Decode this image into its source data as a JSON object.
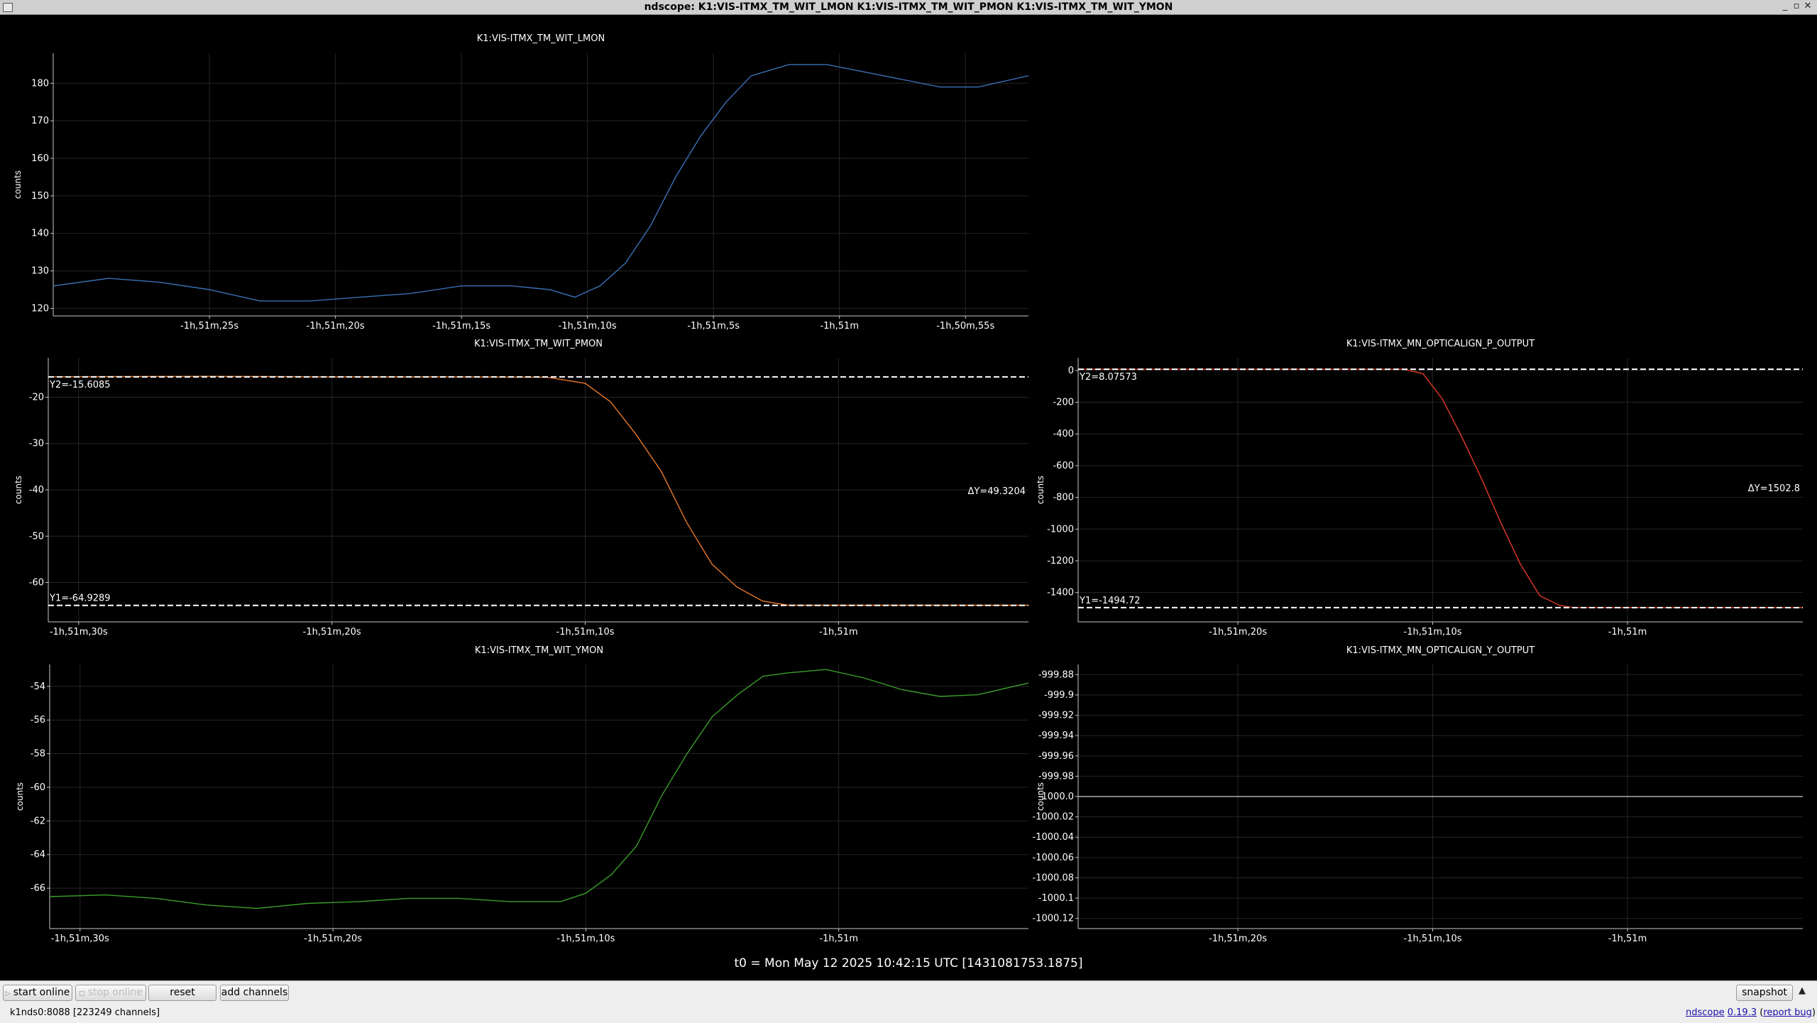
{
  "window": {
    "title": "ndscope: K1:VIS-ITMX_TM_WIT_LMON K1:VIS-ITMX_TM_WIT_PMON K1:VIS-ITMX_TM_WIT_YMON",
    "controls": [
      "_",
      "▫",
      "✕"
    ]
  },
  "t0_label": "t0 = Mon May 12 2025 10:42:15 UTC [1431081753.1875]",
  "toolbar": {
    "start_online": "start online",
    "stop_online": "stop online",
    "reset": "reset",
    "add_channels": "add channels",
    "snapshot": "snapshot",
    "collapse": "▲"
  },
  "status": {
    "server": "k1nds0:8088  [223249 channels]",
    "app_name": "ndscope",
    "version": "0.19.3",
    "report_bug": "report bug"
  },
  "colors": {
    "lmon": "#3a6fb5",
    "pmon": "#e8772a",
    "yaw_pmon": "#e03a2a",
    "ymon": "#3a9e2a",
    "ylink": "#ffffff"
  },
  "plots": [
    {
      "channel": "K1:VIS-ITMX_TM_WIT_LMON",
      "ylabel": "counts",
      "color": "lmon",
      "ylim": [
        118,
        188
      ],
      "yticks": [
        "120",
        "130",
        "140",
        "150",
        "160",
        "170",
        "180"
      ],
      "ytick_values": [
        120,
        130,
        140,
        150,
        160,
        170,
        180
      ],
      "xticks": [
        "-1h,51m,25s",
        "-1h,51m,20s",
        "-1h,51m,15s",
        "-1h,51m,10s",
        "-1h,51m,5s",
        "-1h,51m",
        "-1h,50m,55s"
      ],
      "xtick_values": [
        -6685,
        -6680,
        -6675,
        -6670,
        -6665,
        -6660,
        -6655
      ],
      "xlim": [
        -6691.2,
        -6652.5
      ],
      "series_x": [
        -6691.2,
        -6689.0,
        -6687.0,
        -6685.0,
        -6683.0,
        -6681.0,
        -6679.0,
        -6677.0,
        -6675.0,
        -6673.0,
        -6671.5,
        -6670.5,
        -6669.5,
        -6668.5,
        -6667.5,
        -6666.5,
        -6665.5,
        -6664.5,
        -6663.5,
        -6662.0,
        -6660.5,
        -6659.0,
        -6657.5,
        -6656.0,
        -6654.5,
        -6652.5
      ],
      "series_y": [
        126,
        128,
        127,
        125,
        122,
        122,
        123,
        124,
        126,
        126,
        125,
        123,
        126,
        132,
        142,
        155,
        166,
        175,
        182,
        185,
        185,
        183,
        181,
        179,
        179,
        182
      ]
    },
    {
      "channel": "K1:VIS-ITMX_TM_WIT_PMON",
      "ylabel": "counts",
      "color": "pmon",
      "ylim": [
        -68.5,
        -11.5
      ],
      "yticks": [
        "-20",
        "-30",
        "-40",
        "-50",
        "-60"
      ],
      "ytick_values": [
        -20,
        -30,
        -40,
        -50,
        -60
      ],
      "xticks": [
        "-1h,51m,30s",
        "-1h,51m,20s",
        "-1h,51m,10s",
        "-1h,51m"
      ],
      "xtick_values": [
        -6690,
        -6680,
        -6670,
        -6660
      ],
      "xlim": [
        -6691.2,
        -6652.5
      ],
      "series_x": [
        -6691.2,
        -6685.0,
        -6680.0,
        -6675.0,
        -6671.5,
        -6670.0,
        -6669.0,
        -6668.0,
        -6667.0,
        -6666.0,
        -6665.0,
        -6664.0,
        -6663.0,
        -6662.0,
        -6660.0,
        -6655.0,
        -6652.5
      ],
      "series_y": [
        -15.6,
        -15.5,
        -15.6,
        -15.6,
        -15.7,
        -17.0,
        -21.0,
        -28.0,
        -36.0,
        -47.0,
        -56.0,
        -61.0,
        -64.0,
        -64.9,
        -64.9,
        -64.9,
        -64.9
      ],
      "cursors": {
        "y1": "Y1=-64.9289",
        "y2": "Y2=-15.6085",
        "dy": "ΔY=49.3204",
        "y1_value": -64.9289,
        "y2_value": -15.6085
      }
    },
    {
      "channel": "K1:VIS-ITMX_TM_WIT_YMON",
      "ylabel": "counts",
      "color": "ymon",
      "ylim": [
        -68.4,
        -52.7
      ],
      "yticks": [
        "-54",
        "-56",
        "-58",
        "-60",
        "-62",
        "-64",
        "-66"
      ],
      "ytick_values": [
        -54,
        -56,
        -58,
        -60,
        -62,
        -64,
        -66
      ],
      "xticks": [
        "-1h,51m,30s",
        "-1h,51m,20s",
        "-1h,51m,10s",
        "-1h,51m"
      ],
      "xtick_values": [
        -6690,
        -6680,
        -6670,
        -6660
      ],
      "xlim": [
        -6691.2,
        -6652.5
      ],
      "series_x": [
        -6691.2,
        -6689.0,
        -6687.0,
        -6685.0,
        -6683.0,
        -6681.0,
        -6679.0,
        -6677.0,
        -6675.0,
        -6673.0,
        -6671.0,
        -6670.0,
        -6669.0,
        -6668.0,
        -6667.0,
        -6666.0,
        -6665.0,
        -6664.0,
        -6663.0,
        -6662.0,
        -6660.5,
        -6659.0,
        -6657.5,
        -6656.0,
        -6654.5,
        -6652.5
      ],
      "series_y": [
        -66.5,
        -66.4,
        -66.6,
        -67.0,
        -67.2,
        -66.9,
        -66.8,
        -66.6,
        -66.6,
        -66.8,
        -66.8,
        -66.3,
        -65.2,
        -63.5,
        -60.5,
        -58.0,
        -55.8,
        -54.5,
        -53.4,
        -53.2,
        -53.0,
        -53.5,
        -54.2,
        -54.6,
        -54.5,
        -53.8
      ]
    },
    {
      "channel": "K1:VIS-ITMX_MN_OPTICALIGN_P_OUTPUT",
      "ylabel": "counts",
      "color": "yaw_pmon",
      "ylim": [
        -1585,
        80
      ],
      "yticks": [
        "0",
        "-200",
        "-400",
        "-600",
        "-800",
        "-1000",
        "-1200",
        "-1400"
      ],
      "ytick_values": [
        0,
        -200,
        -400,
        -600,
        -800,
        -1000,
        -1200,
        -1400
      ],
      "xticks": [
        "-1h,51m,20s",
        "-1h,51m,10s",
        "-1h,51m"
      ],
      "xtick_values": [
        -6680,
        -6670,
        -6660
      ],
      "xlim": [
        -6688.2,
        -6651.0
      ],
      "series_x": [
        -6688.2,
        -6685.0,
        -6680.0,
        -6675.0,
        -6671.5,
        -6670.5,
        -6669.5,
        -6668.5,
        -6667.5,
        -6666.5,
        -6665.5,
        -6664.5,
        -6663.5,
        -6662.8,
        -6660.0,
        -6655.0,
        -6651.0
      ],
      "series_y": [
        8.1,
        8.1,
        8.1,
        8.1,
        8.1,
        -20,
        -180,
        -420,
        -680,
        -960,
        -1220,
        -1420,
        -1480,
        -1494.7,
        -1494.7,
        -1494.7,
        -1494.7
      ],
      "cursors": {
        "y1": "Y1=-1494.72",
        "y2": "Y2=8.07573",
        "dy": "ΔY=1502.8",
        "y1_value": -1494.72,
        "y2_value": 8.07573
      }
    },
    {
      "channel": "K1:VIS-ITMX_MN_OPTICALIGN_Y_OUTPUT",
      "ylabel": "counts",
      "color": "ylink",
      "ylim": [
        -1000.13,
        -999.87
      ],
      "yticks": [
        "-999.88",
        "-999.9",
        "-999.92",
        "-999.94",
        "-999.96",
        "-999.98",
        "-1000.0",
        "-1000.02",
        "-1000.04",
        "-1000.06",
        "-1000.08",
        "-1000.1",
        "-1000.12"
      ],
      "ytick_values": [
        -999.88,
        -999.9,
        -999.92,
        -999.94,
        -999.96,
        -999.98,
        -1000.0,
        -1000.02,
        -1000.04,
        -1000.06,
        -1000.08,
        -1000.1,
        -1000.12
      ],
      "xticks": [
        "-1h,51m,20s",
        "-1h,51m,10s",
        "-1h,51m"
      ],
      "xtick_values": [
        -6680,
        -6670,
        -6660
      ],
      "xlim": [
        -6688.2,
        -6651.0
      ],
      "series_x": [
        -6688.2,
        -6651.0
      ],
      "series_y": [
        -1000.0,
        -1000.0
      ]
    }
  ]
}
